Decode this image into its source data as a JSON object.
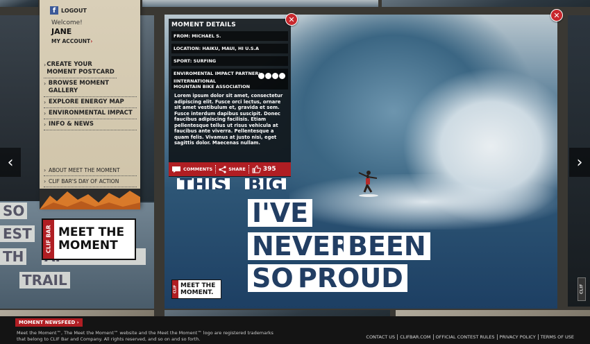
{
  "account": {
    "logout_label": "LOGOUT",
    "welcome": "Welcome!",
    "username": "JANE",
    "my_account": "MY ACCOUNT",
    "fb_icon": "f"
  },
  "menu": [
    {
      "label": "CREATE YOUR MOMENT POSTCARD"
    },
    {
      "label": "BROWSE MOMENT GALLERY"
    },
    {
      "label": "EXPLORE ENERGY MAP"
    },
    {
      "label": "ENVIRONMENTAL IMPACT"
    },
    {
      "label": "INFO & NEWS"
    }
  ],
  "menu_secondary": [
    {
      "label": "ABOUT MEET THE MOMENT"
    },
    {
      "label": "CLIF BAR'S DAY OF ACTION"
    }
  ],
  "brand": {
    "clif_bar": "CLIF BAR",
    "line1": "MEET THE",
    "line2": "MOMENT",
    "mini_clif": "CLIF",
    "mini_line1": "MEET THE",
    "mini_line2": "MOMENT."
  },
  "left_words": [
    "SO",
    "EST",
    "TH",
    "AP",
    "TRAIL"
  ],
  "details": {
    "title": "MOMENT DETAILS",
    "from": "FROM: MICHAEL S.",
    "location": "LOCATION: HAIKU, MAUI, HI U.S.A",
    "sport": "SPORT: SURFING",
    "partner_label": "ENVIROMENTAL IMPACT PARTNER:",
    "partner_name_1": "IINTERNATIONAL",
    "partner_name_2": "MOUNTAIN BIKE ASSOCIATION",
    "body": "Lorem ipsum dolor sit amet, consectetur adipiscing elit. Fusce orci lectus, ornare sit amet vestibulum et, gravida et sem. Fusce interdum dapibus suscipit. Donec faucibus adipiscing facilisis. Etiam pellentesque tellus ut risus vehicula at faucibus ante viverra. Pellentesque a quam felis. Vivamus at justo nisi, eget sagittis dolor. Maecenas nullam."
  },
  "actions": {
    "comments": "COMMENTS",
    "share": "SHARE",
    "likes": "395"
  },
  "phrase": {
    "ghost_1": "THIS",
    "ghost_2": "BIG",
    "w1": "I'VE",
    "w2": "NEVER",
    "w3": "BEEN",
    "w4": "SO",
    "w5": "PROUD"
  },
  "nav": {
    "prev": "‹",
    "next": "›",
    "close": "✕"
  },
  "footer": {
    "newsfeed": "MOMENT NEWSFEED",
    "newsfeed_arrow": "›",
    "legal": "Meet the Moment™, The Meet the Moment™ website and the Meet the Moment™ logo are registered trademarks that belong to CLIF Bar and Company. All rights reserved, and so on and so forth.",
    "links": [
      "CONTACT US",
      "CLIFBAR.COM",
      "OFFICIAL CONTEST RULES",
      "PRIVACY POLICY",
      "TERMS OF USE"
    ],
    "vertical_logo": "CLIF"
  },
  "colors": {
    "accent_red": "#b01e23",
    "panel_tan": "#d9cfb8",
    "ocean_blue": "#223e63"
  }
}
